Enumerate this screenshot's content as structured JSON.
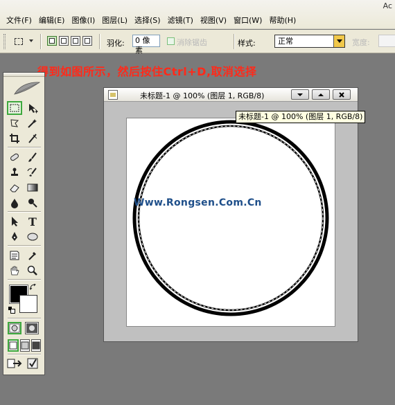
{
  "menubar": {
    "app_title": "Ac",
    "items": [
      {
        "label": "文件(F)"
      },
      {
        "label": "编辑(E)"
      },
      {
        "label": "图像(I)"
      },
      {
        "label": "图层(L)"
      },
      {
        "label": "选择(S)"
      },
      {
        "label": "滤镜(T)"
      },
      {
        "label": "视图(V)"
      },
      {
        "label": "窗口(W)"
      },
      {
        "label": "帮助(H)"
      }
    ]
  },
  "options": {
    "tool_icon": "rect-marquee-icon",
    "feather_label": "羽化:",
    "feather_value": "0 像素",
    "antialias_label": "消除锯齿",
    "antialias_checked": true,
    "style_label": "样式:",
    "style_value": "正常",
    "width_label": "宽度:",
    "width_value": ""
  },
  "instruction": "得到如图所示，然后按住Ctrl+D,取消选择",
  "document": {
    "title": "未标题-1 @ 100% (图层 1, RGB/8)",
    "tooltip": "未标题-1 @ 100% (图层 1, RGB/8)",
    "watermark": "Www.Rongsen.Com.Cn"
  },
  "toolbox": {
    "tools": [
      {
        "name": "rect-marquee-icon",
        "active": true
      },
      {
        "name": "move-icon"
      },
      {
        "name": "lasso-icon"
      },
      {
        "name": "magic-wand-icon"
      },
      {
        "name": "crop-icon"
      },
      {
        "name": "slice-icon"
      },
      {
        "name": "healing-brush-icon"
      },
      {
        "name": "brush-icon"
      },
      {
        "name": "clone-stamp-icon"
      },
      {
        "name": "history-brush-icon"
      },
      {
        "name": "eraser-icon"
      },
      {
        "name": "gradient-icon"
      },
      {
        "name": "blur-icon"
      },
      {
        "name": "dodge-icon"
      },
      {
        "name": "path-select-icon"
      },
      {
        "name": "type-icon",
        "glyph": "T"
      },
      {
        "name": "pen-icon"
      },
      {
        "name": "ellipse-shape-icon"
      },
      {
        "name": "notes-icon"
      },
      {
        "name": "eyedropper-icon"
      },
      {
        "name": "hand-icon"
      },
      {
        "name": "zoom-icon"
      }
    ],
    "foreground_color": "#000000",
    "background_color": "#ffffff"
  },
  "colors": {
    "instruction": "#ff2a1a",
    "watermark": "#1f4f8a",
    "workspace": "#7a7a7a",
    "active_tool_border": "#3da83d"
  }
}
